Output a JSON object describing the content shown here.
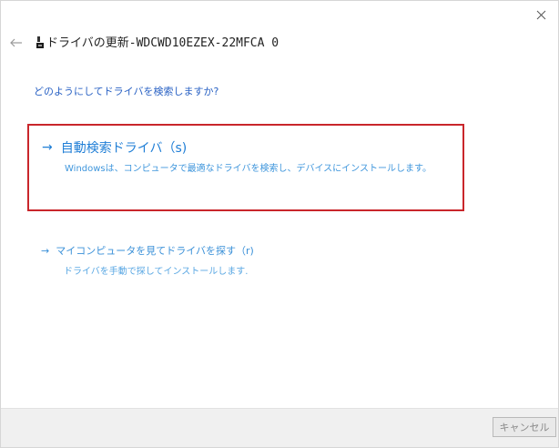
{
  "window": {
    "title": "ドライバの更新-WDCWD10EZEX-22MFCA 0"
  },
  "prompt": {
    "question": "どのようにしてドライバを検索しますか?"
  },
  "options": [
    {
      "arrow": "→",
      "title": "自動検索ドライバ（s)",
      "description": "Windowsは、コンピュータで最適なドライバを検索し、デバイスにインストールします。"
    },
    {
      "arrow": "→",
      "title": "マイコンピュータを見てドライバを探す（r)",
      "description": "ドライバを手動で探してインストールします."
    }
  ],
  "footer": {
    "cancel_label": "キャンセル"
  },
  "colors": {
    "highlight_border": "#c9262b",
    "link_blue": "#1f7ed6",
    "question_blue": "#2a62c4"
  },
  "icons": {
    "close": "close-icon",
    "back": "back-arrow-icon",
    "title": "driver-icon"
  }
}
